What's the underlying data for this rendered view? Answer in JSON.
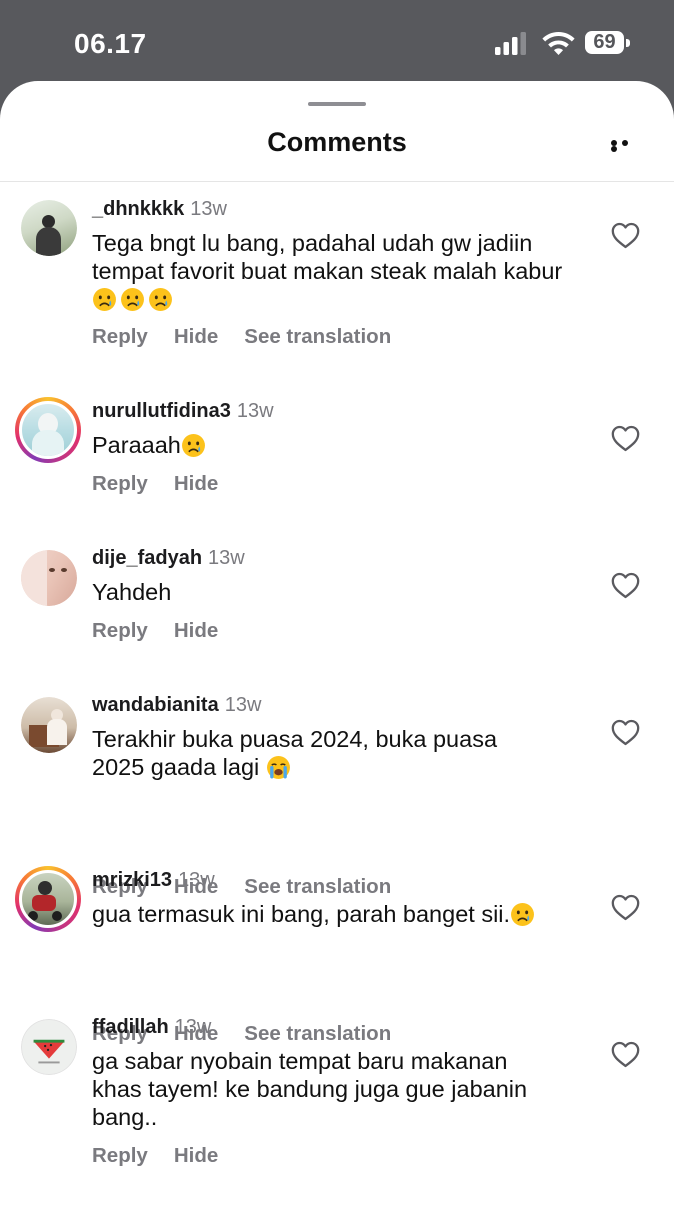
{
  "status_bar": {
    "time": "06.17",
    "battery": "69"
  },
  "header": {
    "title": "Comments"
  },
  "comments": [
    {
      "username": "_dhnkkkk",
      "time": "13w",
      "text": "Tega bngt lu bang, padahal udah gw jadiin tempat favorit buat makan steak malah kabur",
      "emojis": [
        "crying-face",
        "crying-face",
        "crying-face"
      ],
      "actions": [
        "Reply",
        "Hide",
        "See translation"
      ]
    },
    {
      "username": "nurullutfidina3",
      "time": "13w",
      "text": "Paraaah",
      "emojis": [
        "crying-face"
      ],
      "actions": [
        "Reply",
        "Hide"
      ]
    },
    {
      "username": "dije_fadyah",
      "time": "13w",
      "text": "Yahdeh",
      "emojis": [],
      "actions": [
        "Reply",
        "Hide"
      ]
    },
    {
      "username": "wandabianita",
      "time": "13w",
      "text": "Terakhir buka puasa 2024, buka puasa 2025 gaada lagi",
      "emojis": [
        "loudly-crying-face"
      ],
      "actions": [
        "Reply",
        "Hide",
        "See translation"
      ]
    },
    {
      "username": "mrizki13",
      "time": "13w",
      "text": "gua termasuk ini bang, parah banget sii.",
      "emojis": [
        "crying-face"
      ],
      "actions": [
        "Reply",
        "Hide",
        "See translation"
      ]
    },
    {
      "username": "ffadillah",
      "time": "13w",
      "text": "ga sabar nyobain tempat baru makanan khas tayem! ke bandung juga gue jabanin bang..",
      "emojis": [],
      "actions": [
        "Reply",
        "Hide"
      ]
    }
  ]
}
